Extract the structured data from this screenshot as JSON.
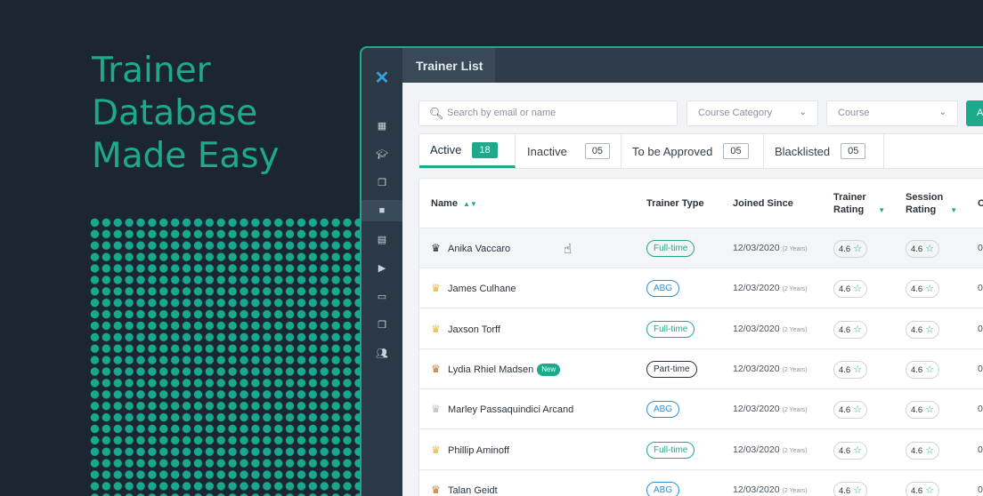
{
  "hero": {
    "lines": [
      "Trainer",
      "Database",
      "Made Easy"
    ]
  },
  "app": {
    "logo": "X",
    "window_title": "Trainer List"
  },
  "sidebar": {
    "icons": [
      "dashboard-icon",
      "graduation-cap-icon",
      "documents-icon",
      "video-camera-icon",
      "screen-icon",
      "play-icon",
      "monitor-icon",
      "copy-icon",
      "users-icon"
    ]
  },
  "filters": {
    "search_placeholder": "Search by email or name",
    "category_placeholder": "Course Category",
    "course_placeholder": "Course",
    "add_label": "A"
  },
  "tabs": [
    {
      "label": "Active",
      "count": "18"
    },
    {
      "label": "Inactive",
      "count": "05"
    },
    {
      "label": "To be Approved",
      "count": "05"
    },
    {
      "label": "Blacklisted",
      "count": "05"
    }
  ],
  "columns": {
    "name": "Name",
    "type": "Trainer Type",
    "joined": "Joined Since",
    "trainer_rating_1": "Trainer",
    "trainer_rating_2": "Rating",
    "session_rating_1": "Session",
    "session_rating_2": "Rating",
    "clipped": "C"
  },
  "rows": [
    {
      "name": "Anika Vaccaro",
      "badge": "",
      "crown": "#2a2f36",
      "type": "Full-time",
      "type_color": "#1fa98c",
      "joined": "12/03/2020",
      "years": "(2 Years)",
      "trainer_rating": "4.6",
      "session_rating": "4.6",
      "clipped": "0"
    },
    {
      "name": "James Culhane",
      "badge": "",
      "crown": "#f2b528",
      "type": "ABG",
      "type_color": "#2f8fd0",
      "joined": "12/03/2020",
      "years": "(2 Years)",
      "trainer_rating": "4.6",
      "session_rating": "4.6",
      "clipped": "0"
    },
    {
      "name": "Jaxson Torff",
      "badge": "",
      "crown": "#f2b528",
      "type": "Full-time",
      "type_color": "#1fa98c",
      "joined": "12/03/2020",
      "years": "(2 Years)",
      "trainer_rating": "4.6",
      "session_rating": "4.6",
      "clipped": "0"
    },
    {
      "name": "Lydia Rhiel Madsen",
      "badge": "New",
      "crown": "#c07a1f",
      "type": "Part-time",
      "type_color": "#2a333d",
      "joined": "12/03/2020",
      "years": "(2 Years)",
      "trainer_rating": "4.6",
      "session_rating": "4.6",
      "clipped": "0"
    },
    {
      "name": "Marley Passaquindici Arcand",
      "badge": "",
      "crown": "#b5bcc3",
      "type": "ABG",
      "type_color": "#2f8fd0",
      "joined": "12/03/2020",
      "years": "(2 Years)",
      "trainer_rating": "4.6",
      "session_rating": "4.6",
      "clipped": "0"
    },
    {
      "name": "Phillip Aminoff",
      "badge": "",
      "crown": "#f2b528",
      "type": "Full-time",
      "type_color": "#1fa98c",
      "joined": "12/03/2020",
      "years": "(2 Years)",
      "trainer_rating": "4.6",
      "session_rating": "4.6",
      "clipped": "0"
    },
    {
      "name": "Talan Geidt",
      "badge": "",
      "crown": "#c07a1f",
      "type": "ABG",
      "type_color": "#2f8fd0",
      "joined": "12/03/2020",
      "years": "(2 Years)",
      "trainer_rating": "4.6",
      "session_rating": "4.6",
      "clipped": "0"
    }
  ]
}
